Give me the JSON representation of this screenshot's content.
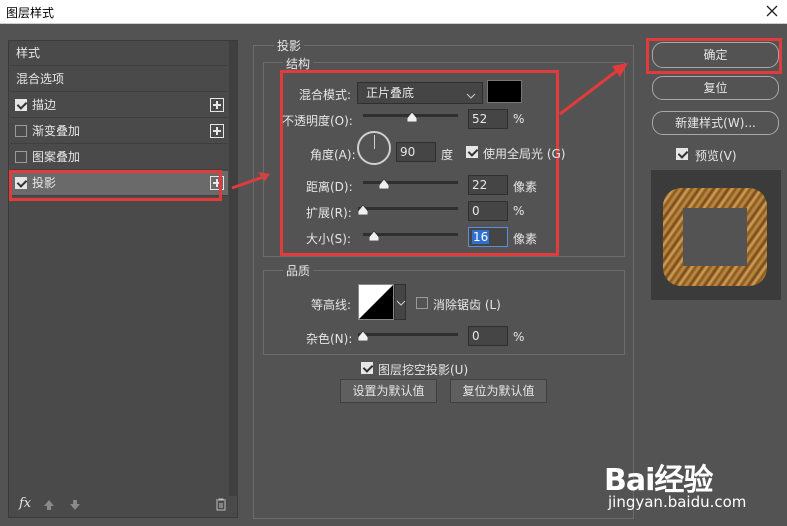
{
  "window": {
    "title": "图层样式"
  },
  "left_panel": {
    "items": [
      {
        "label": "样式",
        "has_checkbox": false,
        "checked": false,
        "has_plus": false
      },
      {
        "label": "混合选项",
        "has_checkbox": false,
        "checked": false,
        "has_plus": false
      },
      {
        "label": "描边",
        "has_checkbox": true,
        "checked": true,
        "has_plus": true
      },
      {
        "label": "渐变叠加",
        "has_checkbox": true,
        "checked": false,
        "has_plus": true
      },
      {
        "label": "图案叠加",
        "has_checkbox": true,
        "checked": false,
        "has_plus": false
      },
      {
        "label": "投影",
        "has_checkbox": true,
        "checked": true,
        "has_plus": true,
        "selected": true
      }
    ],
    "fx_label": "fx"
  },
  "drop_shadow": {
    "section_title": "投影",
    "structure_title": "结构",
    "blend_mode_label": "混合模式:",
    "blend_mode_value": "正片叠底",
    "shadow_color": "#000000",
    "opacity_label": "不透明度(O):",
    "opacity_value": "52",
    "opacity_unit": "%",
    "angle_label": "角度(A):",
    "angle_value": "90",
    "angle_unit": "度",
    "global_light_label": "使用全局光 (G)",
    "global_light_checked": true,
    "distance_label": "距离(D):",
    "distance_value": "22",
    "distance_unit": "像素",
    "spread_label": "扩展(R):",
    "spread_value": "0",
    "spread_unit": "%",
    "size_label": "大小(S):",
    "size_value": "16",
    "size_unit": "像素"
  },
  "quality": {
    "title": "品质",
    "contour_label": "等高线:",
    "anti_alias_label": "消除锯齿 (L)",
    "anti_alias_checked": false,
    "noise_label": "杂色(N):",
    "noise_value": "0",
    "noise_unit": "%",
    "knockout_label": "图层挖空投影(U)",
    "knockout_checked": true,
    "set_default_label": "设置为默认值",
    "reset_default_label": "复位为默认值"
  },
  "right_panel": {
    "ok_label": "确定",
    "reset_label": "复位",
    "new_style_label": "新建样式(W)...",
    "preview_label": "预览(V)",
    "preview_checked": true
  },
  "watermark": {
    "logo": "Bai经验",
    "url": "jingyan.baidu.com"
  },
  "colors": {
    "accent_red": "#e23b3b",
    "panel": "#535353"
  }
}
